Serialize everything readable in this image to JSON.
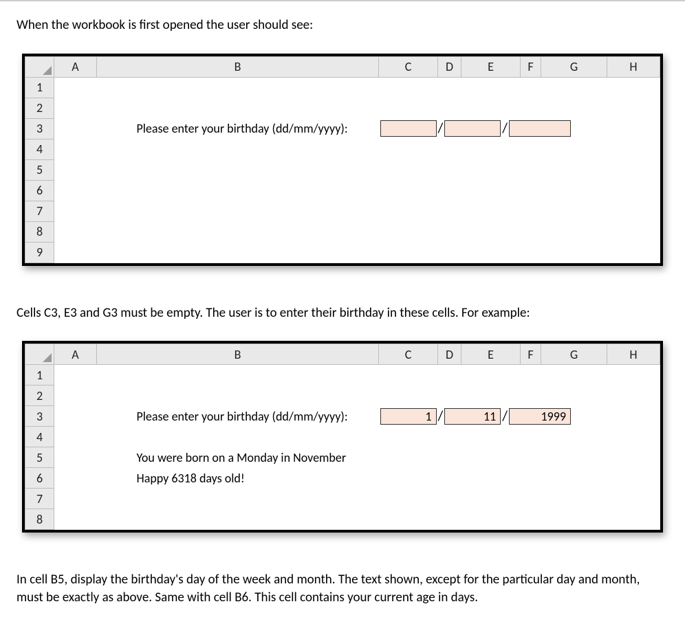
{
  "paragraphs": {
    "p1": "When the workbook is first opened the user should see:",
    "p2": "Cells C3, E3 and G3 must be empty. The user is to enter their birthday in these cells. For example:",
    "p3": "In cell B5, display the birthday's day of the week and month. The text shown, except for the particular day and month, must be exactly as above. Same with cell B6. This cell contains your current age in days."
  },
  "columns": [
    "A",
    "B",
    "C",
    "D",
    "E",
    "F",
    "G",
    "H"
  ],
  "sheet1": {
    "rows": [
      "1",
      "2",
      "3",
      "4",
      "5",
      "6",
      "7",
      "8",
      "9"
    ],
    "b3": "Please enter your birthday (dd/mm/yyyy):",
    "c3": "",
    "d3": "/",
    "e3": "",
    "f3": "/",
    "g3": ""
  },
  "sheet2": {
    "rows": [
      "1",
      "2",
      "3",
      "4",
      "5",
      "6",
      "7",
      "8"
    ],
    "b3": "Please enter your birthday (dd/mm/yyyy):",
    "c3": "1",
    "d3": "/",
    "e3": "11",
    "f3": "/",
    "g3": "1999",
    "b5": "You were born on a Monday in November",
    "b6": "Happy 6318 days old!"
  }
}
